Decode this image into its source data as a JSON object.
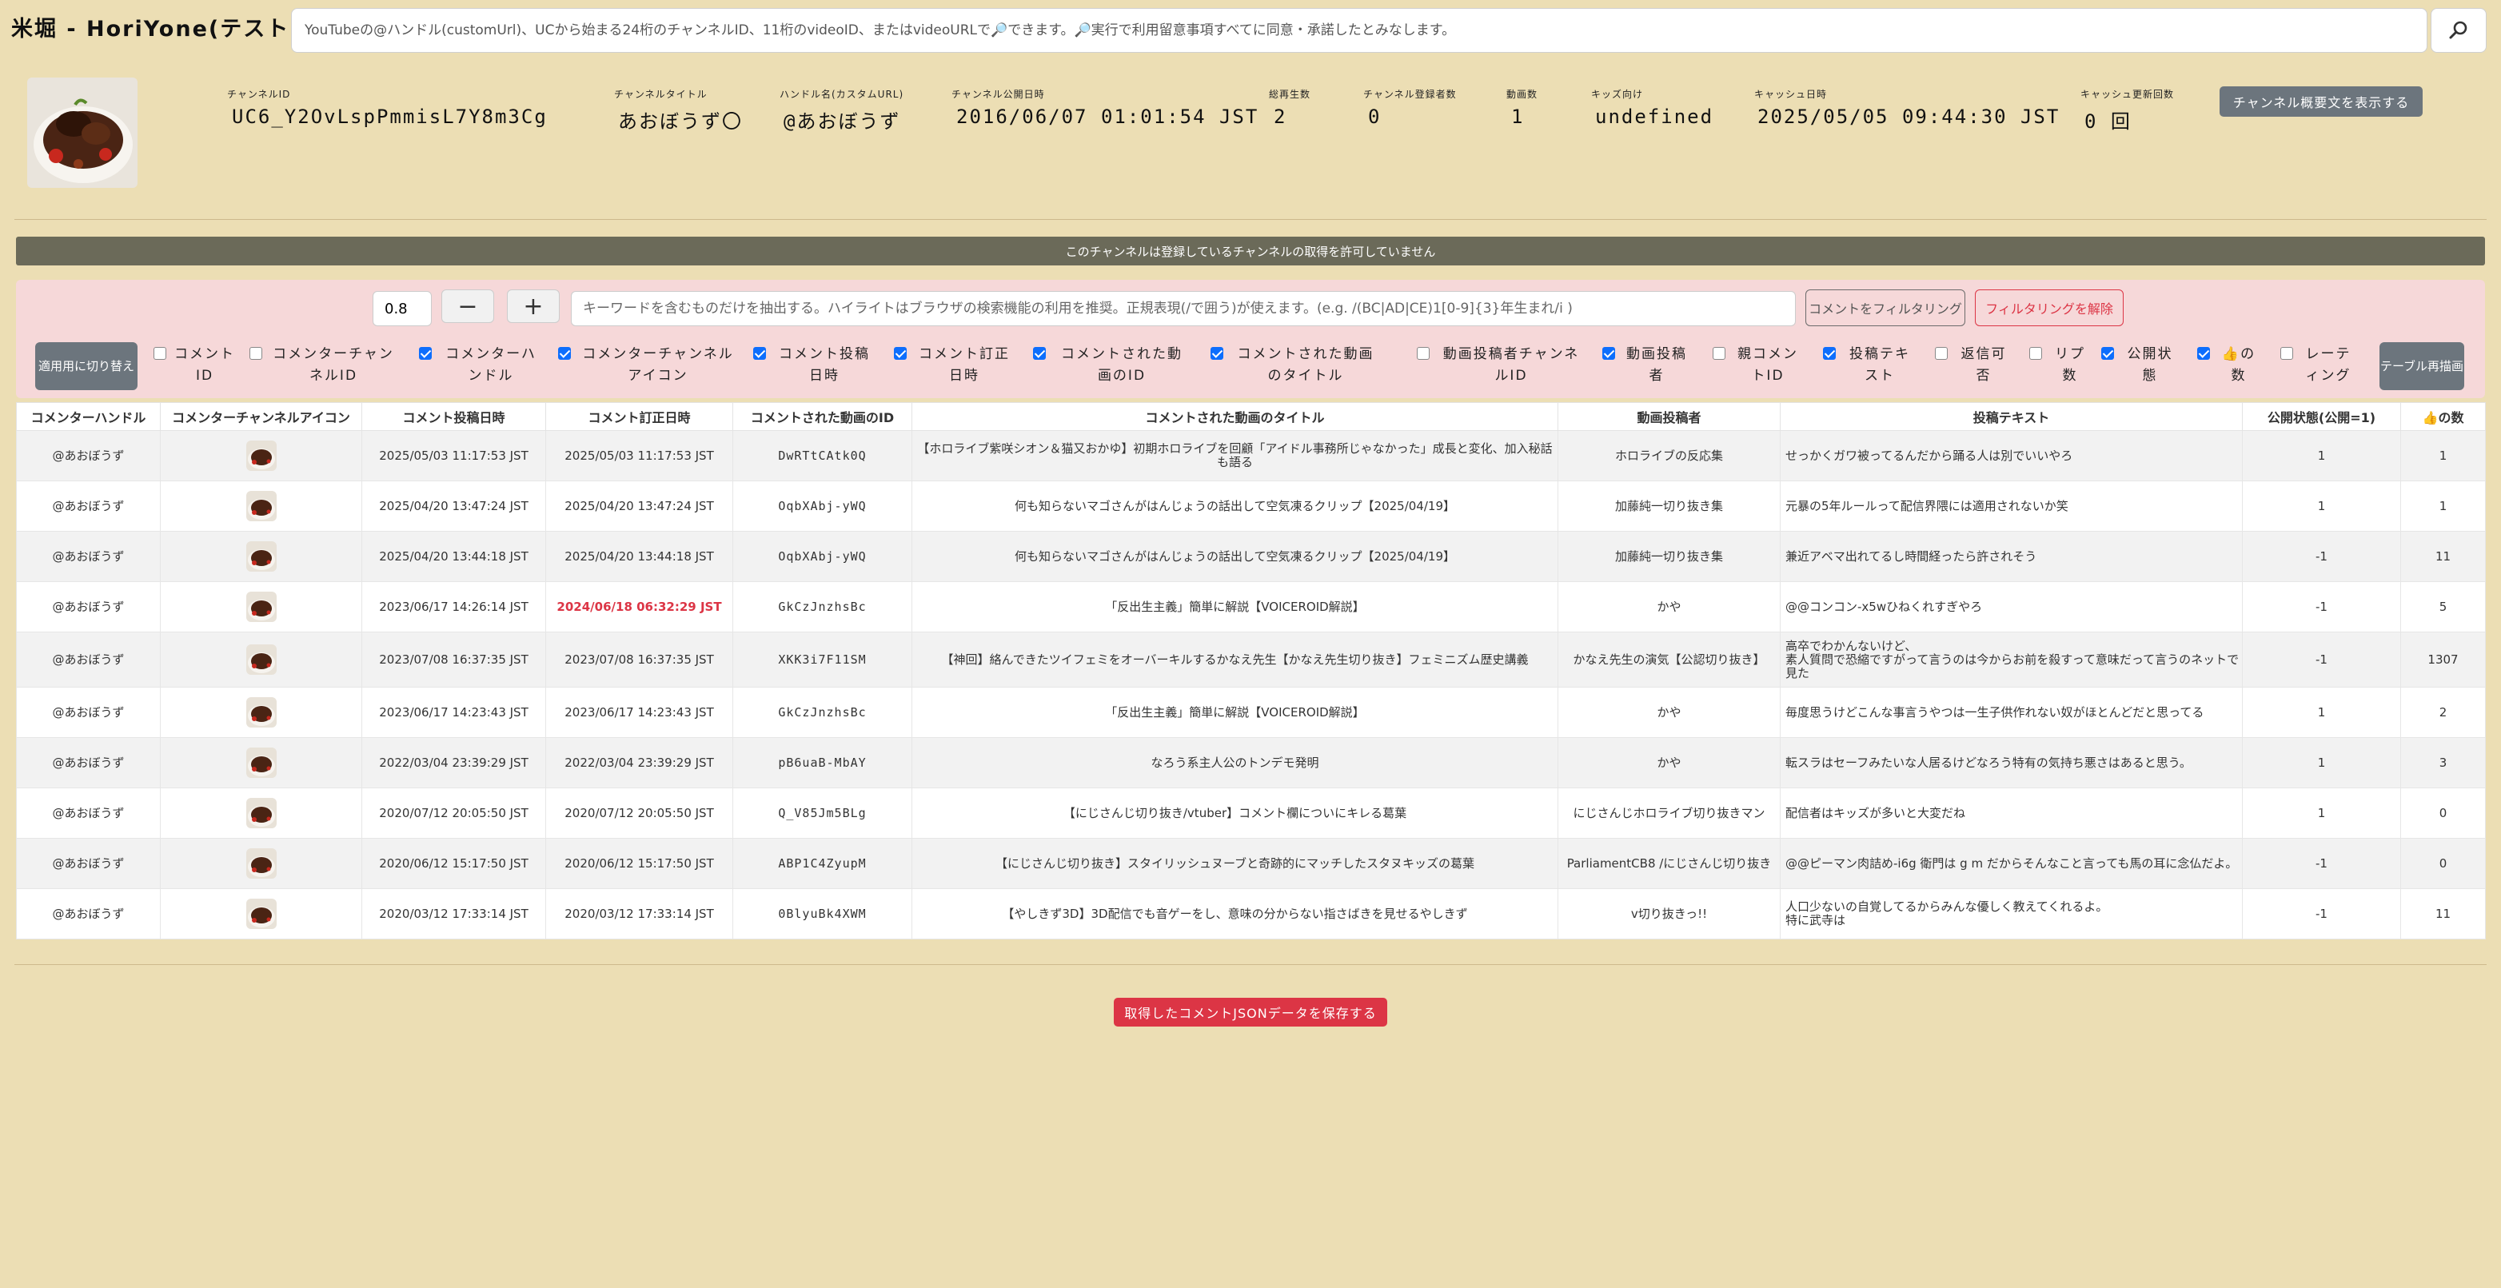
{
  "app": {
    "title": "米堀 - HoriYone(テスト中)"
  },
  "search": {
    "placeholder": "YouTubeの@ハンドル(customUrl)、UCから始まる24桁のチャンネルID、11桁のvideoID、またはvideoURLで🔎できます。🔎実行で利用留意事項すべてに同意・承諾したとみなします。",
    "icon": "search-icon"
  },
  "channel": {
    "id_label": "チャンネルID",
    "id": "UC6_Y2OvLspPmmisL7Y8m3Cg",
    "title_label": "チャンネルタイトル",
    "title": "あおぼうず〇",
    "handle_label": "ハンドル名(カスタムURL)",
    "handle": "@あおぼうず",
    "published_label": "チャンネル公開日時",
    "published": "2016/06/07 01:01:54 JST",
    "views_label": "総再生数",
    "views": "2",
    "subs_label": "チャンネル登録者数",
    "subs": "0",
    "videos_label": "動画数",
    "videos": "1",
    "kids_label": "キッズ向け",
    "kids": "undefined",
    "cache_label": "キャッシュ日時",
    "cache": "2025/05/05 09:44:30 JST",
    "cache_count_label": "キャッシュ更新回数",
    "cache_count": "0 回",
    "overview_button": "チャンネル概要文を表示する"
  },
  "notice": "このチャンネルは登録しているチャンネルの取得を許可していません",
  "filter": {
    "zoom_value": "0.8",
    "minus": "−",
    "plus": "+",
    "keyword_placeholder": "キーワードを含むものだけを抽出する。ハイライトはブラウザの検索機能の利用を推奨。正規表現(/で囲う)が使えます。(e.g. /(BC|AD|CE)1[0-9]{3}年生まれ/i )",
    "filter_button": "コメントをフィルタリング",
    "clear_button": "フィルタリングを解除",
    "mobile_button": "適用用に切り替え",
    "redraw_button": "テーブル再描画"
  },
  "columns": [
    {
      "label": "コメントID",
      "checked": false
    },
    {
      "label": "コメンターチャンネルID",
      "checked": false
    },
    {
      "label": "コメンターハンドル",
      "checked": true
    },
    {
      "label": "コメンターチャンネルアイコン",
      "checked": true
    },
    {
      "label": "コメント投稿日時",
      "checked": true
    },
    {
      "label": "コメント訂正日時",
      "checked": true
    },
    {
      "label": "コメントされた動画のID",
      "checked": true
    },
    {
      "label": "コメントされた動画のタイトル",
      "checked": true
    },
    {
      "label": "動画投稿者チャンネルID",
      "checked": false
    },
    {
      "label": "動画投稿者",
      "checked": true
    },
    {
      "label": "親コメントID",
      "checked": false
    },
    {
      "label": "投稿テキスト",
      "checked": true
    },
    {
      "label": "返信可否",
      "checked": false
    },
    {
      "label": "リプ数",
      "checked": false
    },
    {
      "label": "公開状態",
      "checked": true
    },
    {
      "label": "👍の数",
      "checked": true
    },
    {
      "label": "レーティング",
      "checked": false
    }
  ],
  "table": {
    "headers": [
      "コメンターハンドル",
      "コメンターチャンネルアイコン",
      "コメント投稿日時",
      "コメント訂正日時",
      "コメントされた動画のID",
      "コメントされた動画のタイトル",
      "動画投稿者",
      "投稿テキスト",
      "公開状態(公開=1)",
      "👍の数"
    ],
    "rows": [
      {
        "handle": "@あおぼうず",
        "posted": "2025/05/03 11:17:53 JST",
        "edited": "2025/05/03 11:17:53 JST",
        "video_id": "DwRTtCAtk0Q",
        "video_title": "【ホロライブ紫咲シオン＆猫又おかゆ】初期ホロライブを回顧「アイドル事務所じゃなかった」成長と変化、加入秘話も語る",
        "uploader": "ホロライブの反応集",
        "text": "せっかくガワ被ってるんだから踊る人は別でいいやろ",
        "public": "1",
        "likes": "1"
      },
      {
        "handle": "@あおぼうず",
        "posted": "2025/04/20 13:47:24 JST",
        "edited": "2025/04/20 13:47:24 JST",
        "video_id": "OqbXAbj-yWQ",
        "video_title": "何も知らないマゴさんがはんじょうの話出して空気凍るクリップ【2025/04/19】",
        "uploader": "加藤純一切り抜き集",
        "text": "元暴の5年ルールって配信界隈には適用されないか笑",
        "public": "1",
        "likes": "1"
      },
      {
        "handle": "@あおぼうず",
        "posted": "2025/04/20 13:44:18 JST",
        "edited": "2025/04/20 13:44:18 JST",
        "video_id": "OqbXAbj-yWQ",
        "video_title": "何も知らないマゴさんがはんじょうの話出して空気凍るクリップ【2025/04/19】",
        "uploader": "加藤純一切り抜き集",
        "text": "兼近アベマ出れてるし時間経ったら許されそう",
        "public": "-1",
        "likes": "11"
      },
      {
        "handle": "@あおぼうず",
        "posted": "2023/06/17 14:26:14 JST",
        "edited": "2024/06/18 06:32:29 JST",
        "edited_highlight": true,
        "video_id": "GkCzJnzhsBc",
        "video_title": "「反出生主義」簡単に解説【VOICEROID解説】",
        "uploader": "かや",
        "text": "@@コンコン-x5wひねくれすぎやろ",
        "public": "-1",
        "likes": "5"
      },
      {
        "handle": "@あおぼうず",
        "posted": "2023/07/08 16:37:35 JST",
        "edited": "2023/07/08 16:37:35 JST",
        "video_id": "XKK3i7F11SM",
        "video_title": "【神回】絡んできたツイフェミをオーバーキルするかなえ先生【かなえ先生切り抜き】フェミニズム歴史講義",
        "uploader": "かなえ先生の演気【公認切り抜き】",
        "text": "高卒でわかんないけど、\n素人質問で恐縮ですがって言うのは今からお前を殺すって意味だって言うのネットで見た",
        "public": "-1",
        "likes": "1307"
      },
      {
        "handle": "@あおぼうず",
        "posted": "2023/06/17 14:23:43 JST",
        "edited": "2023/06/17 14:23:43 JST",
        "video_id": "GkCzJnzhsBc",
        "video_title": "「反出生主義」簡単に解説【VOICEROID解説】",
        "uploader": "かや",
        "text": "毎度思うけどこんな事言うやつは一生子供作れない奴がほとんどだと思ってる",
        "public": "1",
        "likes": "2"
      },
      {
        "handle": "@あおぼうず",
        "posted": "2022/03/04 23:39:29 JST",
        "edited": "2022/03/04 23:39:29 JST",
        "video_id": "pB6uaB-MbAY",
        "video_title": "なろう系主人公のトンデモ発明",
        "uploader": "かや",
        "text": "転スラはセーフみたいな人居るけどなろう特有の気持ち悪さはあると思う。",
        "public": "1",
        "likes": "3"
      },
      {
        "handle": "@あおぼうず",
        "posted": "2020/07/12 20:05:50 JST",
        "edited": "2020/07/12 20:05:50 JST",
        "video_id": "Q_V85Jm5BLg",
        "video_title": "【にじさんじ切り抜き/vtuber】コメント欄についにキレる葛葉",
        "uploader": "にじさんじホロライブ切り抜きマン",
        "text": "配信者はキッズが多いと大変だね",
        "public": "1",
        "likes": "0"
      },
      {
        "handle": "@あおぼうず",
        "posted": "2020/06/12 15:17:50 JST",
        "edited": "2020/06/12 15:17:50 JST",
        "video_id": "ABP1C4ZyupM",
        "video_title": "【にじさんじ切り抜き】スタイリッシュヌーブと奇跡的にマッチしたスタヌキッズの葛葉",
        "uploader": "ParliamentCB8 /にじさんじ切り抜き",
        "text": "@@ピーマン肉詰め-i6g 衛門は g m だからそんなこと言っても馬の耳に念仏だよ。",
        "public": "-1",
        "likes": "0"
      },
      {
        "handle": "@あおぼうず",
        "posted": "2020/03/12 17:33:14 JST",
        "edited": "2020/03/12 17:33:14 JST",
        "video_id": "0BlyuBk4XWM",
        "video_title": "【やしきず3D】3D配信でも音ゲーをし、意味の分からない指さばきを見せるやしきず",
        "uploader": "v切り抜きっ!!",
        "text": "人口少ないの自覚してるからみんな優しく教えてくれるよ。\n特に武寺は",
        "public": "-1",
        "likes": "11"
      }
    ]
  },
  "save_button": "取得したコメントJSONデータを保存する"
}
